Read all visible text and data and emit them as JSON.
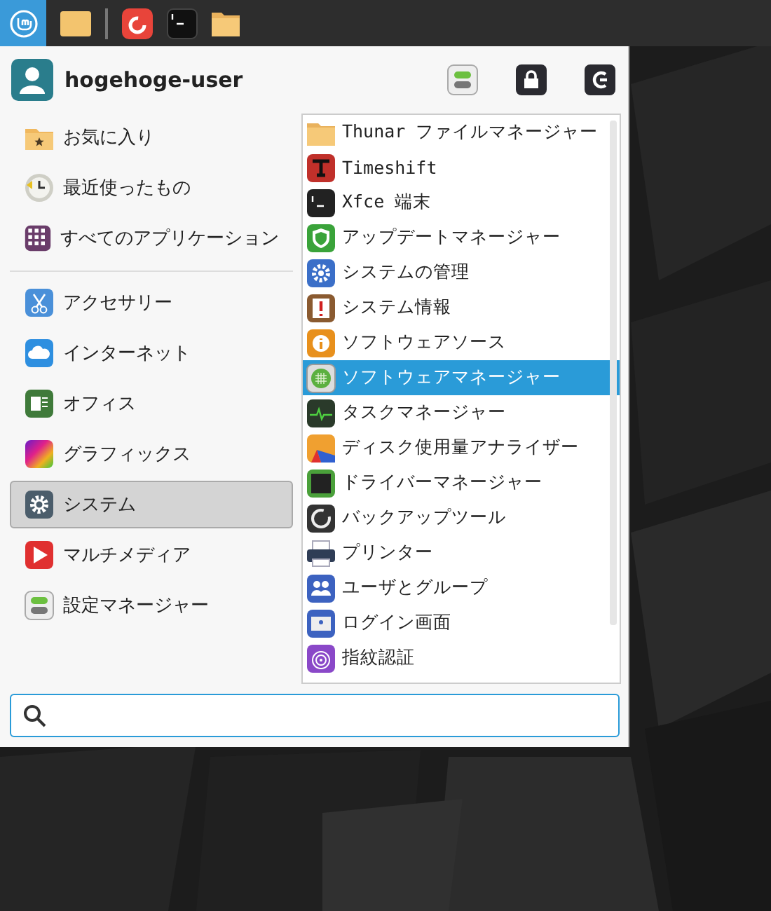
{
  "user": {
    "name": "hogehoge-user"
  },
  "places": [
    {
      "label": "お気に入り",
      "selected": false
    },
    {
      "label": "最近使ったもの",
      "selected": false
    },
    {
      "label": "すべてのアプリケーション",
      "selected": false
    }
  ],
  "categories": [
    {
      "label": "アクセサリー",
      "selected": false
    },
    {
      "label": "インターネット",
      "selected": false
    },
    {
      "label": "オフィス",
      "selected": false
    },
    {
      "label": "グラフィックス",
      "selected": false
    },
    {
      "label": "システム",
      "selected": true
    },
    {
      "label": "マルチメディア",
      "selected": false
    },
    {
      "label": "設定マネージャー",
      "selected": false
    }
  ],
  "apps": [
    {
      "label": "Thunar ファイルマネージャー",
      "selected": false
    },
    {
      "label": "Timeshift",
      "selected": false
    },
    {
      "label": "Xfce 端末",
      "selected": false
    },
    {
      "label": "アップデートマネージャー",
      "selected": false
    },
    {
      "label": "システムの管理",
      "selected": false
    },
    {
      "label": "システム情報",
      "selected": false
    },
    {
      "label": "ソフトウェアソース",
      "selected": false
    },
    {
      "label": "ソフトウェアマネージャー",
      "selected": true
    },
    {
      "label": "タスクマネージャー",
      "selected": false
    },
    {
      "label": "ディスク使用量アナライザー",
      "selected": false
    },
    {
      "label": "ドライバーマネージャー",
      "selected": false
    },
    {
      "label": "バックアップツール",
      "selected": false
    },
    {
      "label": "プリンター",
      "selected": false
    },
    {
      "label": "ユーザとグループ",
      "selected": false
    },
    {
      "label": "ログイン画面",
      "selected": false
    },
    {
      "label": "指紋認証",
      "selected": false
    }
  ]
}
